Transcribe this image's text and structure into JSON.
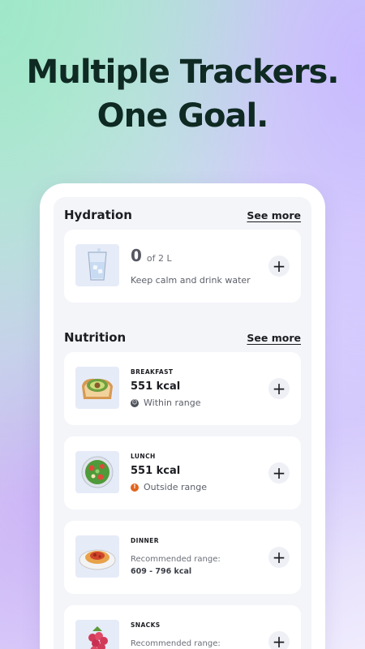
{
  "headline": {
    "line1": "Multiple Trackers.",
    "line2": "One Goal."
  },
  "hydration": {
    "title": "Hydration",
    "see_more": "See more",
    "amount": "0",
    "of_label": "of 2 L",
    "tip": "Keep calm and drink water",
    "add_label": "+",
    "icon": "water-glass-icon"
  },
  "nutrition": {
    "title": "Nutrition",
    "see_more": "See more",
    "meals": [
      {
        "name": "BREAKFAST",
        "kcal": "551 kcal",
        "status": "Within range",
        "status_color": "#4b4e57",
        "icon": "avocado-toast-icon",
        "add_label": "+"
      },
      {
        "name": "LUNCH",
        "kcal": "551 kcal",
        "status": "Outside range",
        "status_color": "#e2641e",
        "icon": "salad-bowl-icon",
        "add_label": "+"
      },
      {
        "name": "DINNER",
        "range_label": "Recommended range:",
        "range_value": "609 - 796 kcal",
        "icon": "pasta-plate-icon",
        "add_label": "+"
      },
      {
        "name": "SNACKS",
        "range_label": "Recommended range:",
        "icon": "raspberry-icon",
        "add_label": "+"
      }
    ]
  },
  "colors": {
    "headline": "#0f2a22",
    "card": "#ffffff",
    "screen_bg": "#f4f5f9",
    "thumb_bg": "#e6ebf8",
    "warning": "#e2641e"
  }
}
